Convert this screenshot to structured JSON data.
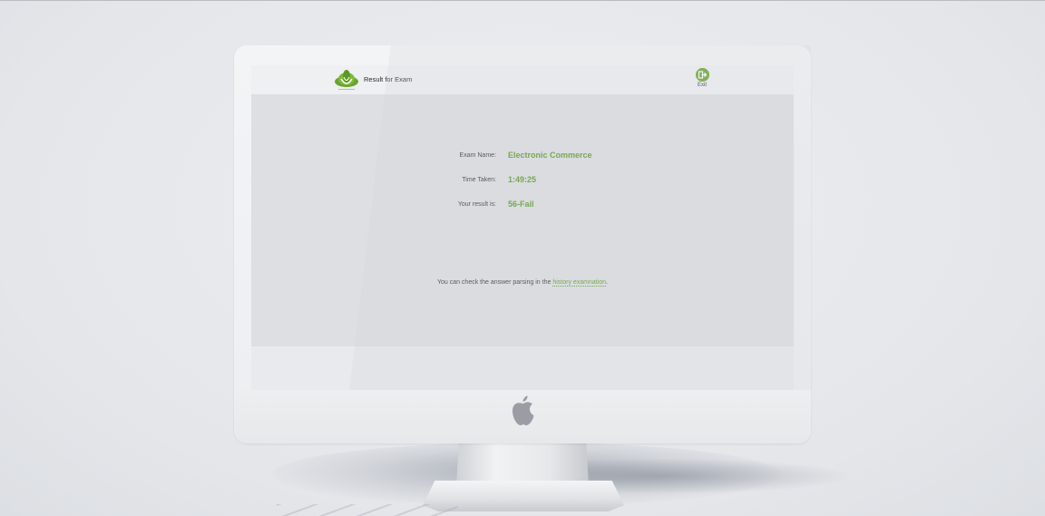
{
  "header": {
    "logo_caption": "",
    "page_title": "Result for  Exam",
    "exit_label": "Exit"
  },
  "result": {
    "exam_name_label": "Exam Name:",
    "exam_name_value": "Electronic Commerce",
    "time_taken_label": "Time Taken:",
    "time_taken_value": "1:49:25",
    "result_label": "Your result is:",
    "result_value": "56-Fail"
  },
  "hint": {
    "prefix": "You can check the answer parsing in the ",
    "link": "history examnation",
    "suffix": "."
  },
  "colors": {
    "accent": "#5a9a24",
    "exit_button": "#6aa42d",
    "content_bg": "#dddfe2"
  },
  "icons": {
    "logo": "lotus-logo-icon",
    "exit": "exit-arrow-icon",
    "apple": "apple-logo-icon"
  }
}
